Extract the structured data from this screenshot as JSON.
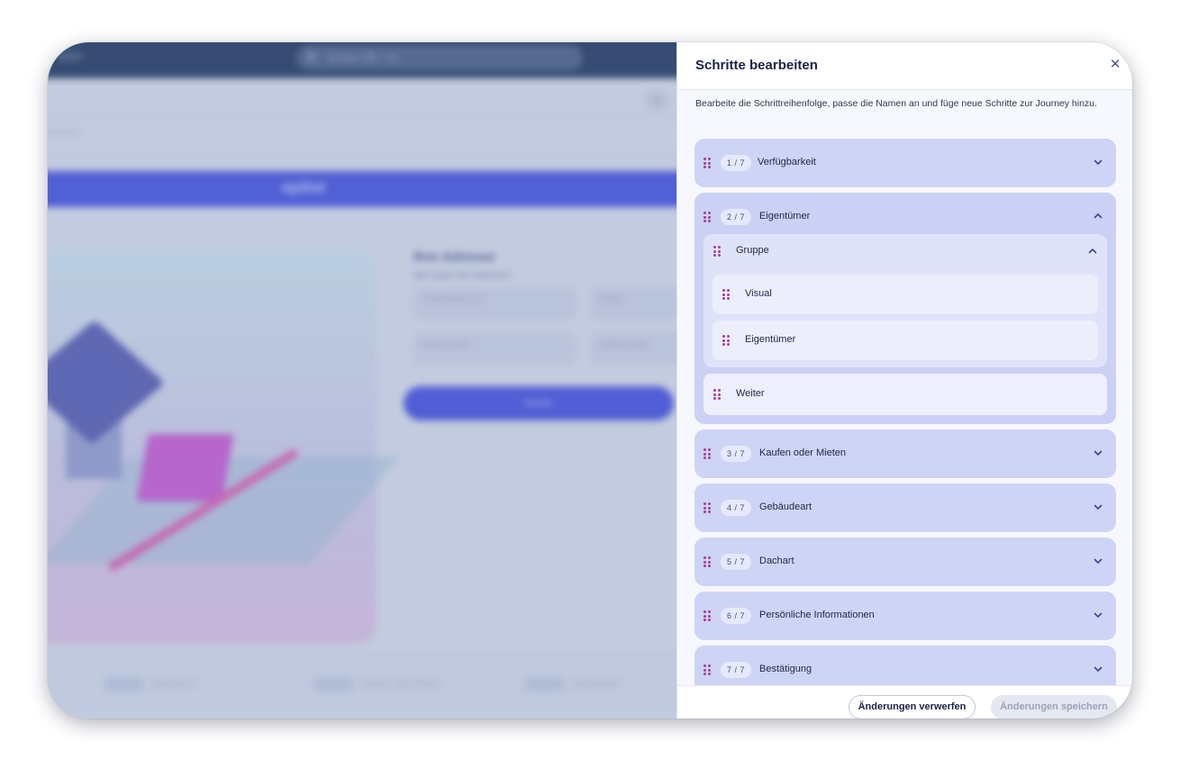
{
  "background_app": {
    "search_placeholder": "Suchen (⌘ + K)",
    "brand": "epilot",
    "logo": "epilot",
    "breadcrumb": "Journeys",
    "form_title": "Ihre Adresse",
    "form_subtitle": "Wie lautet Ihre Adresse?",
    "fields": [
      "Postleitzahl & Ort",
      "Straße",
      "Hausnummer",
      "Adresszusatz"
    ],
    "button": "Weiter",
    "bottom_steps": [
      "Eigentümer",
      "Kaufen oder Mieten",
      "Gebäudeart"
    ]
  },
  "panel": {
    "title": "Schritte bearbeiten",
    "close_icon": "close-icon",
    "description": "Bearbeite die Schrittreihenfolge, passe die Namen an und füge neue Schritte zur Journey hinzu.",
    "steps": [
      {
        "badge": "1 / 7",
        "name": "Verfügbarkeit",
        "expanded": false
      },
      {
        "badge": "2 / 7",
        "name": "Eigentümer",
        "expanded": true,
        "group": {
          "name": "Gruppe",
          "children": [
            "Visual",
            "Eigentümer"
          ]
        },
        "after_group": "Weiter"
      },
      {
        "badge": "3 / 7",
        "name": "Kaufen oder Mieten",
        "expanded": false
      },
      {
        "badge": "4 / 7",
        "name": "Gebäudeart",
        "expanded": false
      },
      {
        "badge": "5 / 7",
        "name": "Dachart",
        "expanded": false
      },
      {
        "badge": "6 / 7",
        "name": "Persönliche Informationen",
        "expanded": false
      },
      {
        "badge": "7 / 7",
        "name": "Bestätigung",
        "expanded": false
      }
    ],
    "footer": {
      "discard_label": "Änderungen verwerfen",
      "save_label": "Änderungen speichern"
    }
  },
  "colors": {
    "accent": "#3744d8",
    "step_bg": "#ced4f5",
    "grip": "#a73c9a",
    "title": "#1b2346"
  }
}
